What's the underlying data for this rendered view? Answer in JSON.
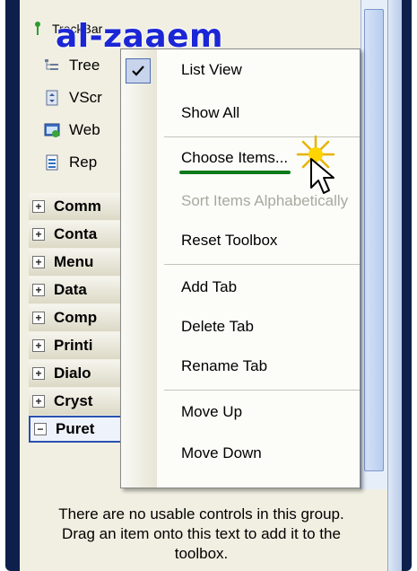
{
  "watermark": "al-zaaem",
  "toolbox": {
    "top_item": "TrackBar",
    "items": [
      {
        "label": "Tree",
        "icon": "treeview-icon"
      },
      {
        "label": "VScr",
        "icon": "vscrollbar-icon"
      },
      {
        "label": "Web",
        "icon": "webbrowser-icon"
      },
      {
        "label": "Rep",
        "icon": "reportviewer-icon"
      }
    ],
    "categories": [
      {
        "label": "Comm"
      },
      {
        "label": "Conta"
      },
      {
        "label": "Menu"
      },
      {
        "label": "Data"
      },
      {
        "label": "Comp"
      },
      {
        "label": "Printi"
      },
      {
        "label": "Dialo"
      },
      {
        "label": "Cryst"
      },
      {
        "label": "Puret"
      }
    ],
    "empty_message": "There are no usable controls in this group. Drag an item onto this text to add it to the toolbox."
  },
  "context_menu": {
    "items": [
      {
        "label": "List View",
        "checked": true,
        "enabled": true
      },
      {
        "label": "Show All",
        "checked": false,
        "enabled": true
      },
      {
        "label": "Choose Items...",
        "checked": false,
        "enabled": true
      },
      {
        "label": "Sort Items Alphabetically",
        "checked": false,
        "enabled": false
      },
      {
        "label": "Reset Toolbox",
        "checked": false,
        "enabled": true
      },
      {
        "label": "Add Tab",
        "checked": false,
        "enabled": true
      },
      {
        "label": "Delete Tab",
        "checked": false,
        "enabled": true
      },
      {
        "label": "Rename Tab",
        "checked": false,
        "enabled": true
      },
      {
        "label": "Move Up",
        "checked": false,
        "enabled": true
      },
      {
        "label": "Move Down",
        "checked": false,
        "enabled": true
      }
    ]
  },
  "colors": {
    "watermark": "#1b26d6",
    "highlight_underline": "#0b7a1a",
    "frame": "#0d1f4a"
  }
}
